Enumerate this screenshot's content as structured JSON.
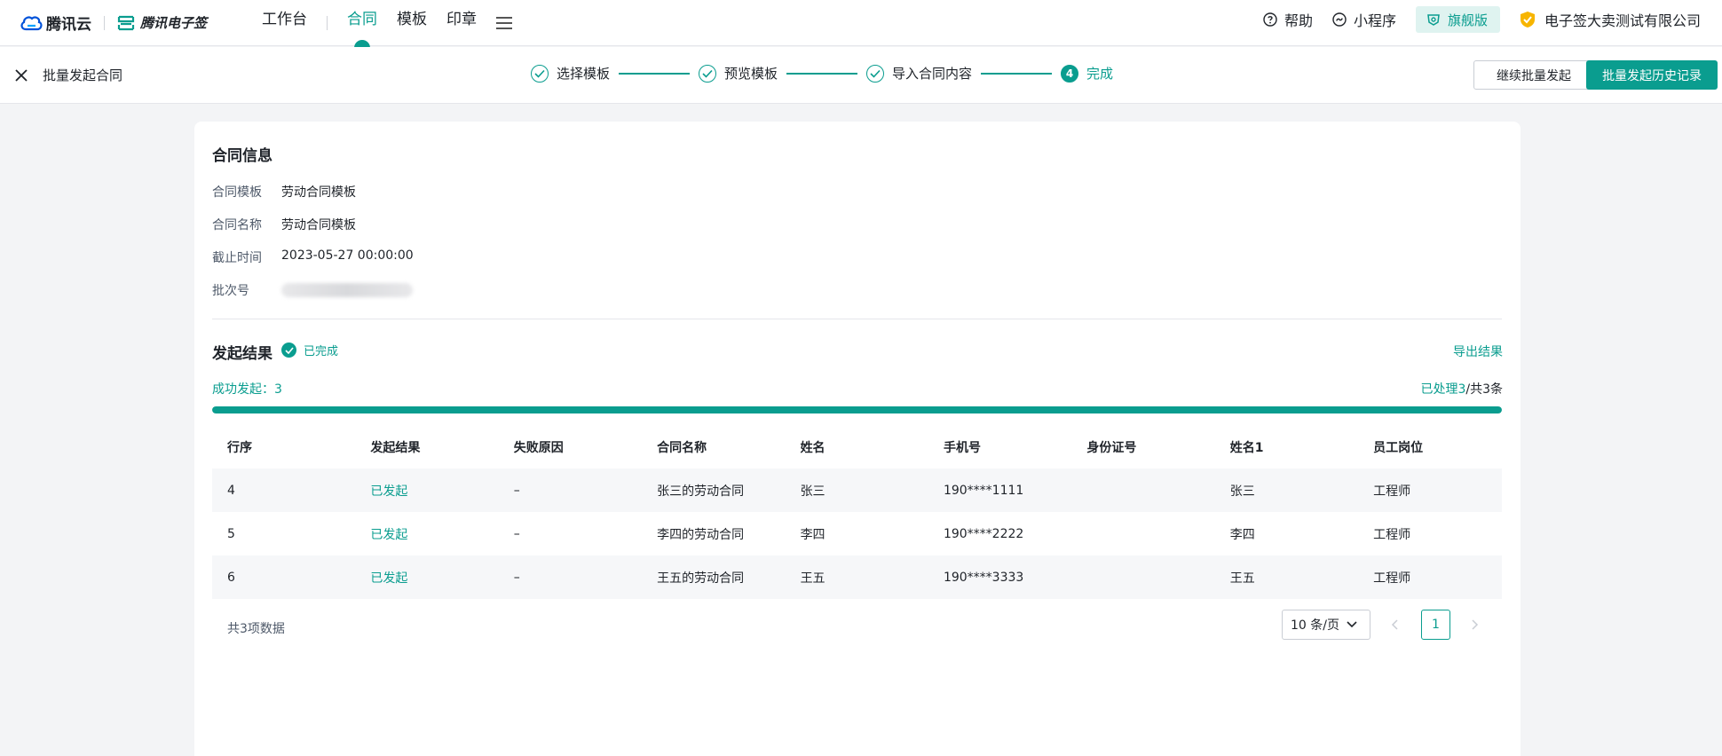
{
  "brand": {
    "cloud_name": "腾讯云",
    "product_name": "腾讯电子签"
  },
  "nav": {
    "items": [
      {
        "label": "工作台"
      },
      {
        "label": "合同",
        "active": true
      },
      {
        "label": "模板"
      },
      {
        "label": "印章"
      }
    ],
    "menu_icon": "hamburger-icon"
  },
  "top_right": {
    "help": "帮助",
    "mini_program": "小程序",
    "edition": "旗舰版",
    "company": "电子签大卖测试有限公司"
  },
  "stepbar": {
    "title": "批量发起合同",
    "steps": [
      {
        "label": "选择模板",
        "status": "done"
      },
      {
        "label": "预览模板",
        "status": "done"
      },
      {
        "label": "导入合同内容",
        "status": "done"
      },
      {
        "label": "完成",
        "status": "current",
        "number": "4"
      }
    ],
    "continue_button": "继续批量发起",
    "history_button": "批量发起历史记录"
  },
  "contract_info": {
    "title": "合同信息",
    "rows": [
      {
        "label": "合同模板",
        "value": "劳动合同模板"
      },
      {
        "label": "合同名称",
        "value": "劳动合同模板"
      },
      {
        "label": "截止时间",
        "value": "2023-05-27 00:00:00"
      },
      {
        "label": "批次号",
        "value": ""
      }
    ]
  },
  "result": {
    "title": "发起结果",
    "status": "已完成",
    "export": "导出结果",
    "success_label": "成功发起：3",
    "processed_prefix": "已处理3",
    "processed_suffix": "/共3条",
    "progress": 1.0,
    "columns": [
      "行序",
      "发起结果",
      "失败原因",
      "合同名称",
      "姓名",
      "手机号",
      "身份证号",
      "姓名1",
      "员工岗位"
    ],
    "rows": [
      [
        "4",
        "已发起",
        "–",
        "张三的劳动合同",
        "张三",
        "190****1111",
        "",
        "张三",
        "工程师"
      ],
      [
        "5",
        "已发起",
        "–",
        "李四的劳动合同",
        "李四",
        "190****2222",
        "",
        "李四",
        "工程师"
      ],
      [
        "6",
        "已发起",
        "–",
        "王五的劳动合同",
        "王五",
        "190****3333",
        "",
        "王五",
        "工程师"
      ]
    ],
    "total": "共3项数据",
    "page_size": "10 条/页",
    "current_page": "1"
  },
  "colors": {
    "accent": "#0a9d8f",
    "brand_blue": "#0052d9"
  }
}
